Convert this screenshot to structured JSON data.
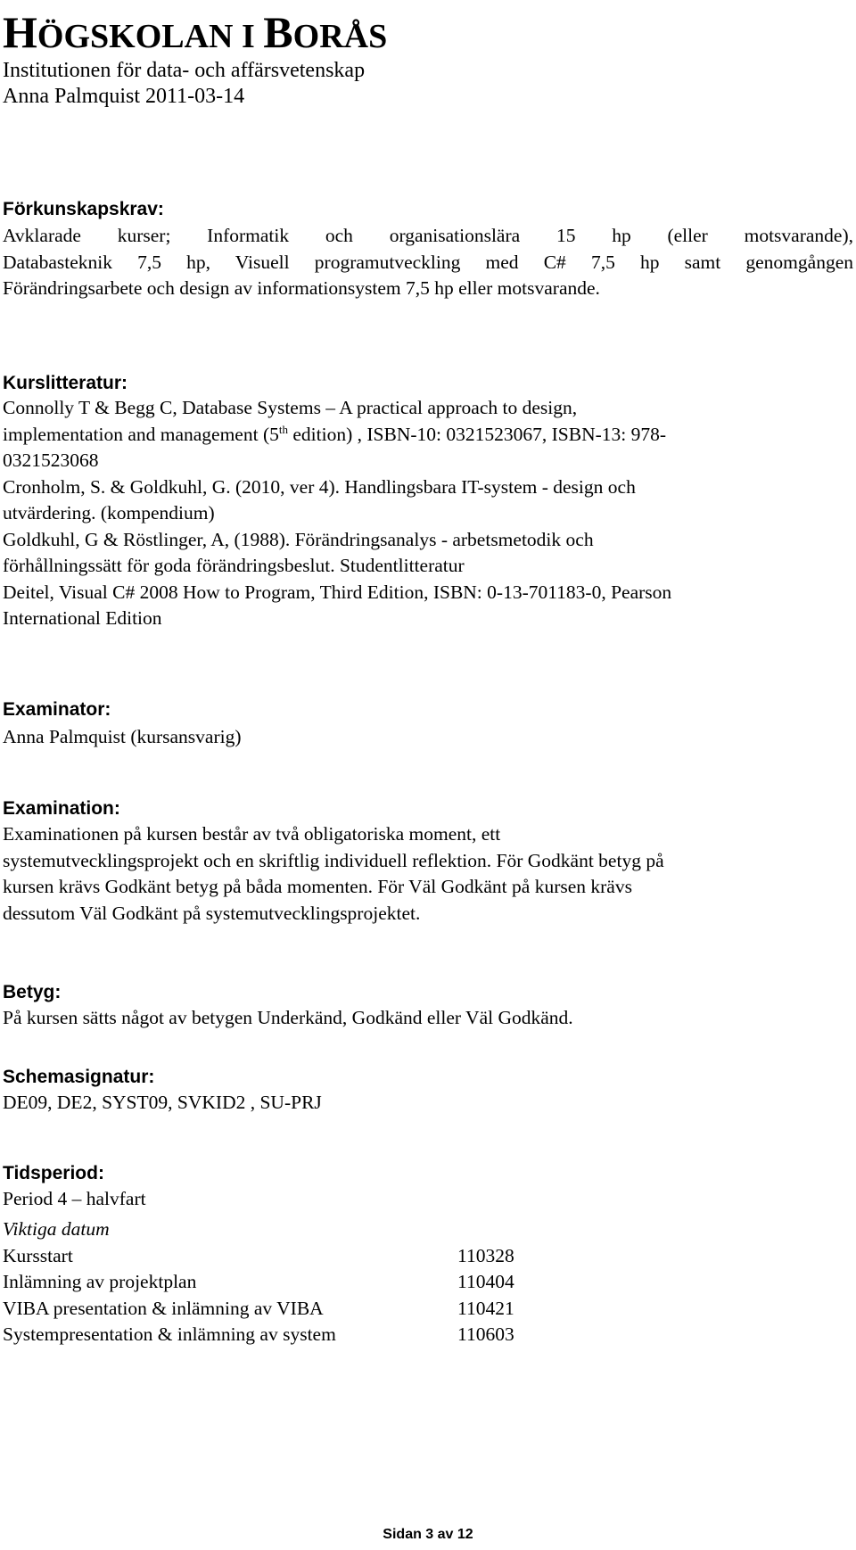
{
  "header": {
    "title_first_a": "H",
    "title_small_a": "ÖGSKOLAN I ",
    "title_first_b": "B",
    "title_small_b": "ORÅS",
    "institution": "Institutionen för data- och affärsvetenskap",
    "author_date": "Anna Palmquist 2011-03-14"
  },
  "prerequisites": {
    "heading": "Förkunskapskrav:",
    "lines": [
      "Avklarade kurser; Informatik och organisationslära 15 hp (eller motsvarande),",
      "Databasteknik 7,5 hp, Visuell programutveckling med C# 7,5 hp samt genomgången",
      "Förändringsarbete och design av informationsystem 7,5 hp eller motsvarande."
    ]
  },
  "literature": {
    "heading": "Kurslitteratur:",
    "line1": "Connolly T & Begg C, Database Systems – A practical approach to design,",
    "line2_pre": "implementation and management (5",
    "line2_sup": "th",
    "line2_post": " edition) , ISBN-10: 0321523067, ISBN-13: 978-",
    "line3": "0321523068",
    "line4": "Cronholm, S. & Goldkuhl, G. (2010, ver 4). Handlingsbara IT-system - design och",
    "line5": "utvärdering. (kompendium)",
    "line6": "Goldkuhl, G & Röstlinger, A, (1988). Förändringsanalys - arbetsmetodik och",
    "line7": "förhållningssätt för goda förändringsbeslut. Studentlitteratur",
    "line8": "Deitel, Visual C# 2008 How to Program, Third Edition, ISBN: 0-13-701183-0, Pearson",
    "line9": "International Edition"
  },
  "examiner": {
    "heading": "Examinator:",
    "text": "Anna Palmquist (kursansvarig)"
  },
  "examination": {
    "heading": "Examination:",
    "lines": [
      "Examinationen på kursen består av två obligatoriska moment, ett",
      "systemutvecklingsprojekt och en skriftlig individuell reflektion. För Godkänt betyg på",
      "kursen krävs Godkänt betyg på båda momenten. För Väl Godkänt på kursen krävs",
      "dessutom Väl Godkänt på systemutvecklingsprojektet."
    ]
  },
  "grade": {
    "heading": "Betyg:",
    "text": "På kursen sätts något av betygen Underkänd, Godkänd eller Väl Godkänd."
  },
  "schedule": {
    "heading": "Schemasignatur:",
    "text": "DE09, DE2, SYST09, SVKID2 , SU-PRJ"
  },
  "period": {
    "heading": "Tidsperiod:",
    "text": "Period 4 – halvfart"
  },
  "important_dates": {
    "heading": "Viktiga datum",
    "rows": [
      {
        "label": "Kursstart",
        "date": "110328"
      },
      {
        "label": "Inlämning av projektplan",
        "date": "110404"
      },
      {
        "label": "VIBA presentation & inlämning av VIBA",
        "date": "110421"
      },
      {
        "label": "Systempresentation & inlämning av system",
        "date": "110603"
      }
    ]
  },
  "footer": {
    "page_label": "Sidan 3 av 12"
  }
}
